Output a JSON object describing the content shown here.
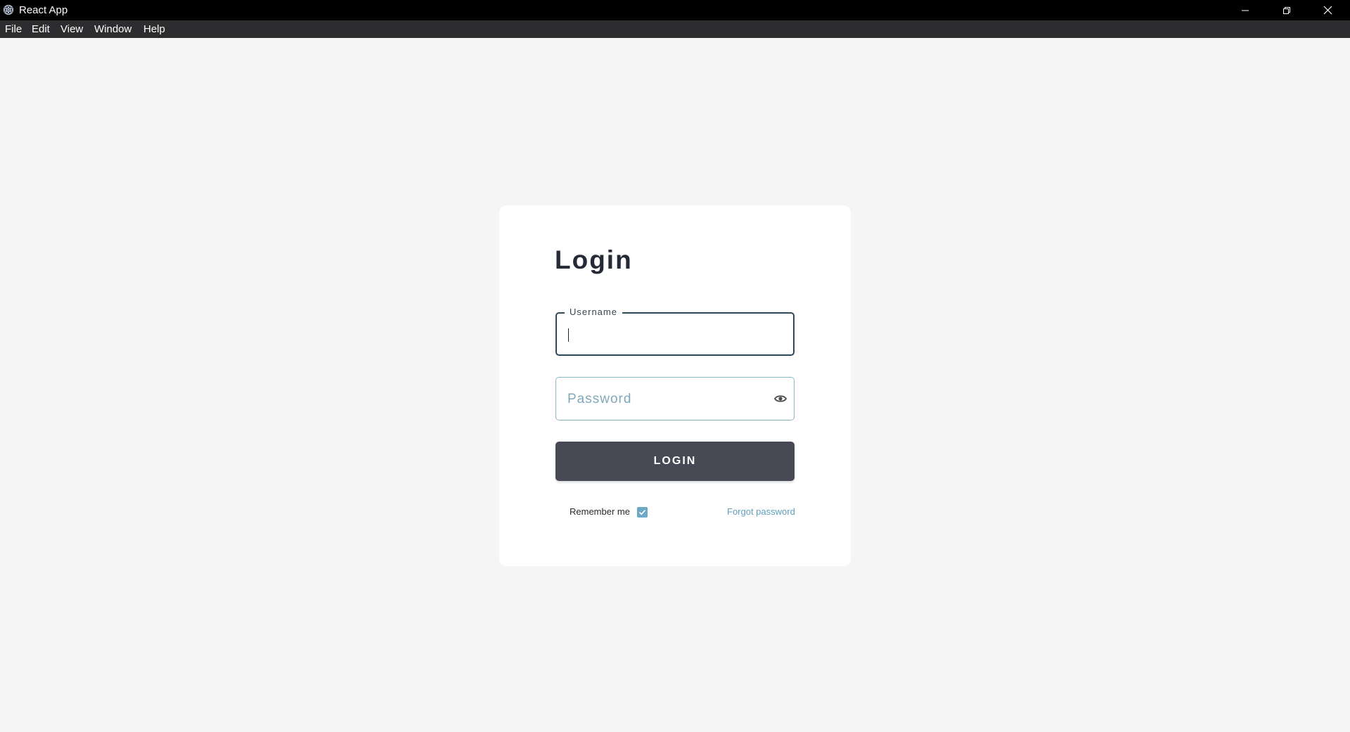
{
  "window": {
    "title": "React App",
    "controls": {
      "minimize_icon": "minimize-icon",
      "maximize_icon": "restore-icon",
      "close_icon": "close-icon"
    }
  },
  "menubar": {
    "items": [
      {
        "label": "File"
      },
      {
        "label": "Edit"
      },
      {
        "label": "View"
      },
      {
        "label": "Window"
      },
      {
        "label": "Help"
      }
    ]
  },
  "login_form": {
    "title": "Login",
    "username": {
      "label": "Username",
      "value": ""
    },
    "password": {
      "placeholder": "Password",
      "value": "",
      "toggle_icon": "eye-icon"
    },
    "submit_label": "LOGIN",
    "remember_me": {
      "label": "Remember me",
      "checked": true
    },
    "forgot_password_label": "Forgot password"
  },
  "colors": {
    "titlebar_bg": "#000000",
    "menubar_bg": "#2d2d30",
    "page_bg": "#f5f5f5",
    "card_bg": "#ffffff",
    "button_bg": "#474a54",
    "accent": "#6fa8c4",
    "link": "#5e9fbd"
  }
}
